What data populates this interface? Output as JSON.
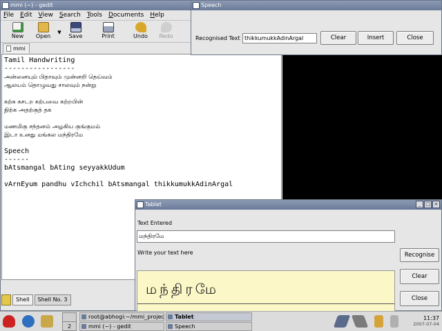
{
  "gedit": {
    "title": "mmi (~) - gedit",
    "menu": [
      "File",
      "Edit",
      "View",
      "Search",
      "Tools",
      "Documents",
      "Help"
    ],
    "toolbar": {
      "new": "New",
      "open": "Open",
      "save": "Save",
      "print": "Print",
      "undo": "Undo",
      "redo": "Redo"
    },
    "tab": "mmi",
    "lines": [
      {
        "text": "Tamil Handwriting",
        "tamil": false
      },
      {
        "text": "-----------------",
        "tamil": false
      },
      {
        "text": "அன்னையும் பிதாவும் முன்னறி தெய்வம்",
        "tamil": true
      },
      {
        "text": "ஆலயம் தொழுவது சாலவும் நன்று",
        "tamil": true
      },
      {
        "text": "",
        "tamil": false
      },
      {
        "text": "கற்க கசடற கற்பவை கற்றபின்",
        "tamil": true
      },
      {
        "text": "நிற்க அதற்குத் தக",
        "tamil": true
      },
      {
        "text": "",
        "tamil": false
      },
      {
        "text": "மணமிகு சந்தனம் அழகிய குங்குமம்",
        "tamil": true
      },
      {
        "text": "இடா உனது மங்கல மந்திரமே",
        "tamil": true
      },
      {
        "text": "",
        "tamil": false
      },
      {
        "text": "Speech",
        "tamil": false
      },
      {
        "text": "------",
        "tamil": false
      },
      {
        "text": "bAtsmangal bAting seyyakkUdum",
        "tamil": false
      },
      {
        "text": "",
        "tamil": false
      },
      {
        "text": "vArnEyum pandhu vIchchil bAtsmangal thikkumukkAdinArgal",
        "tamil": false
      }
    ],
    "status": {
      "shell_tab": "Shell",
      "shell_tab2": "Shell No. 3"
    }
  },
  "speech": {
    "title": "Speech",
    "recognised_label": "Recognised Text",
    "recognised_value": "thikkumukkAdinArgal",
    "clear": "Clear",
    "insert": "Insert",
    "close": "Close"
  },
  "tablet": {
    "title": "Tablet",
    "text_entered_label": "Text Entered",
    "text_entered_value": "மந்திரமே",
    "write_label": "Write your text here",
    "handwriting": "மந்திரமே",
    "recognise": "Recognise",
    "clear": "Clear",
    "close": "Close"
  },
  "taskbar": {
    "pager": [
      "",
      "2"
    ],
    "tasks": [
      "root@abhogi:~/mmi_project/...",
      "mmi (~) - gedit",
      "Tablet",
      "Speech"
    ],
    "time": "11:37",
    "date": "2007-07-04"
  },
  "wm_buttons": {
    "min": "_",
    "max": "□",
    "close": "×"
  }
}
